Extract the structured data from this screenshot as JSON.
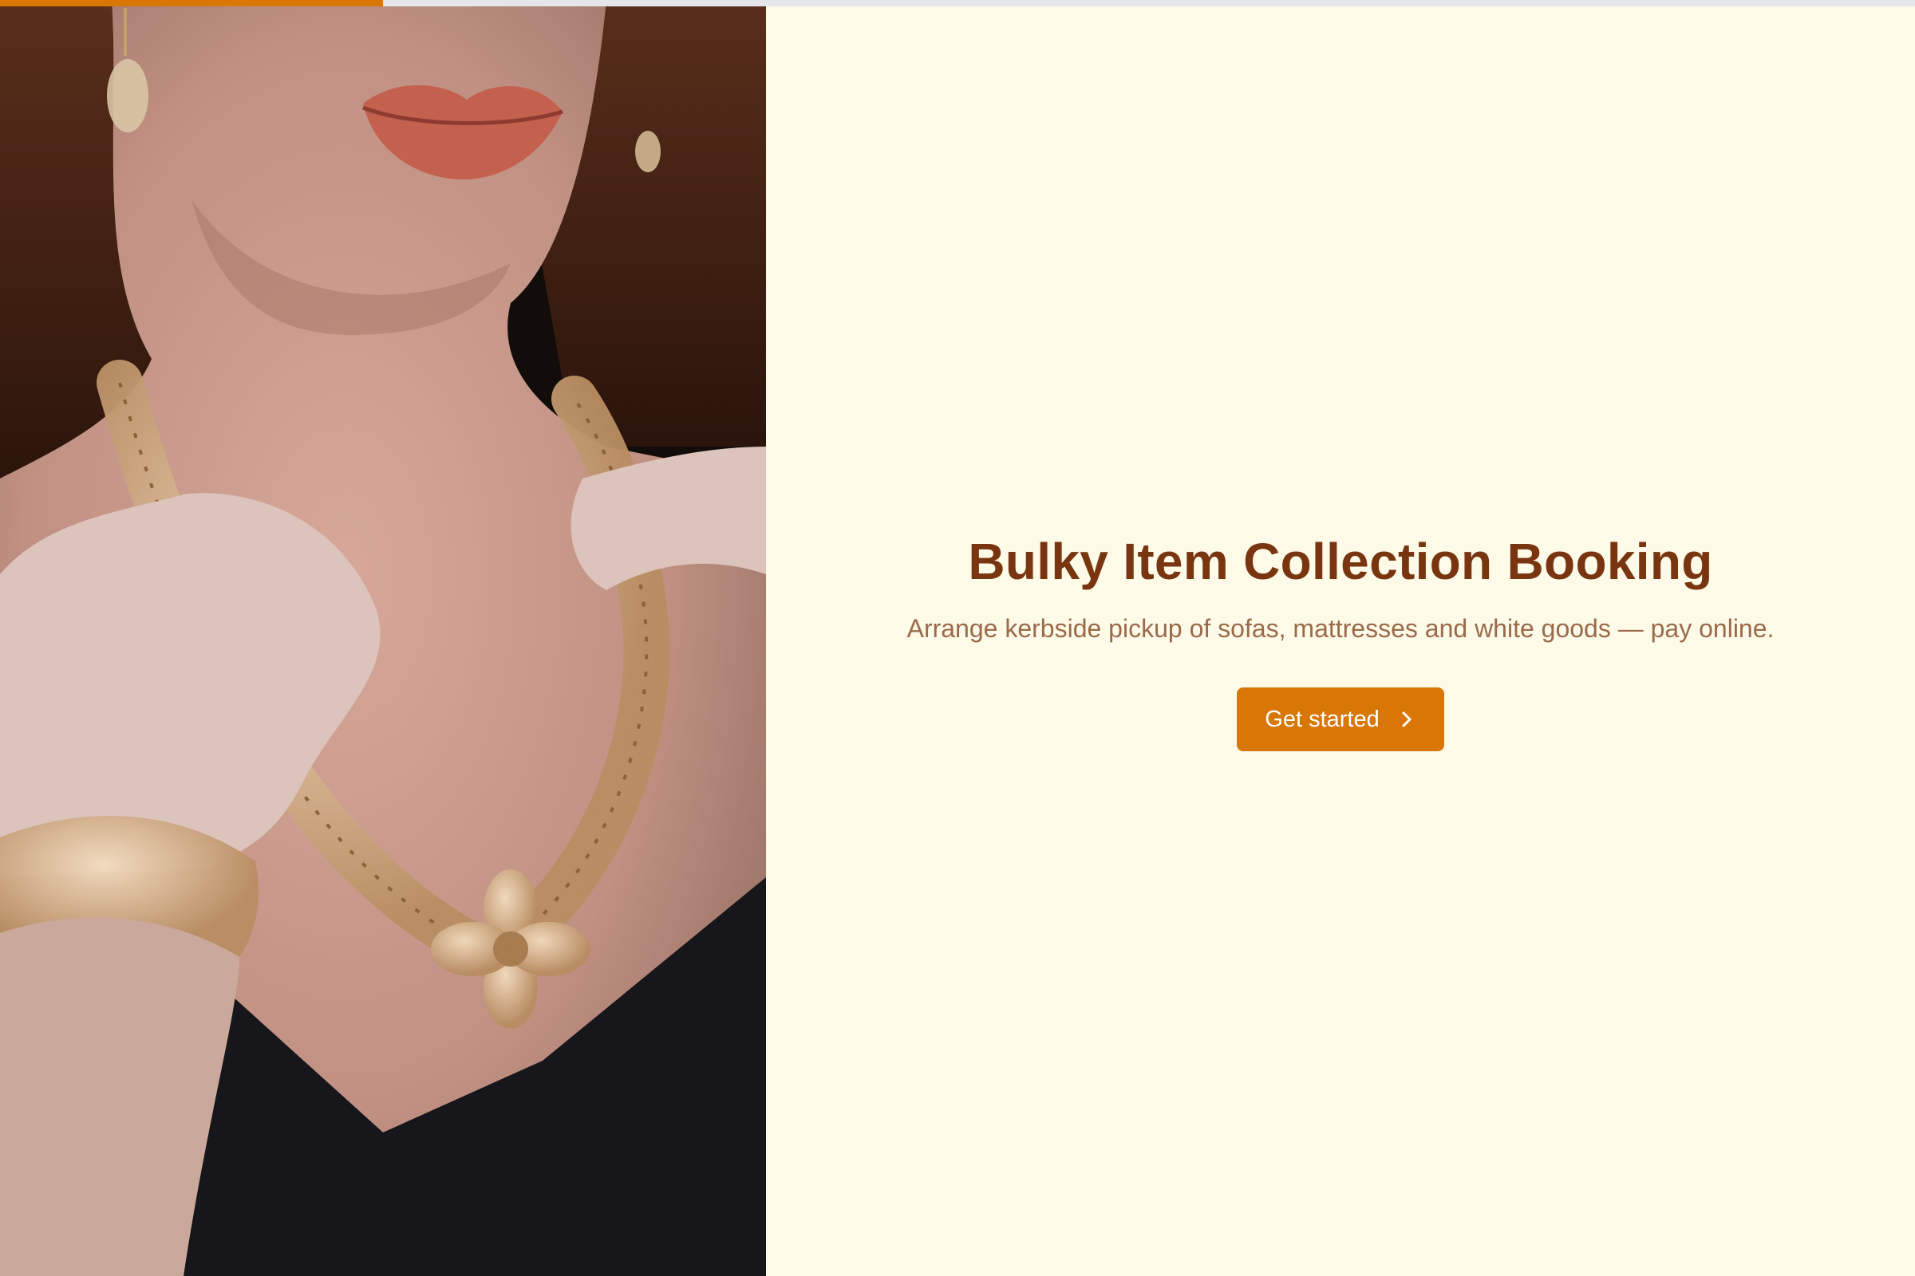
{
  "progress": {
    "fraction": 0.2,
    "color": "#d97706"
  },
  "hero": {
    "title": "Bulky Item Collection Booking",
    "subtitle": "Arrange kerbside pickup of sofas, mattresses and white goods — pay online.",
    "cta_label": "Get started",
    "cta_icon": "chevron-right-icon"
  },
  "colors": {
    "background": "#fefae8",
    "title": "#78350f",
    "subtitle": "#9a6a4a",
    "accent": "#d97706"
  }
}
